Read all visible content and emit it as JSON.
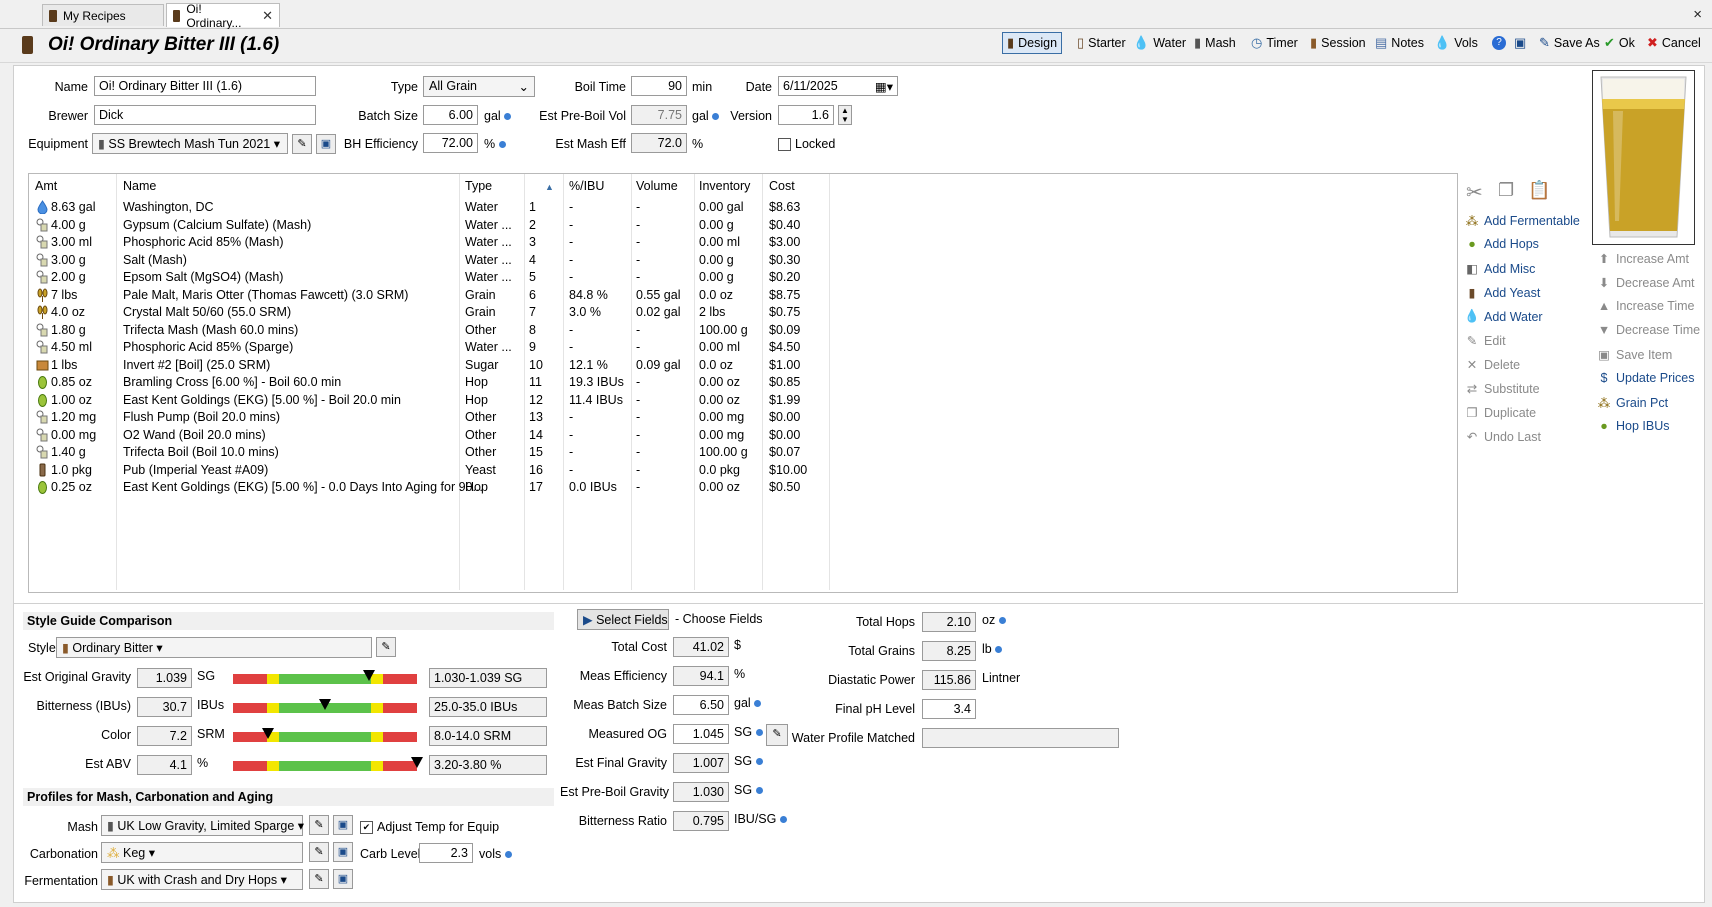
{
  "tabs": [
    {
      "label": "My Recipes",
      "active": false
    },
    {
      "label": "Oi! Ordinary...",
      "active": true
    }
  ],
  "window_close": "×",
  "recipe_title": "Oi! Ordinary Bitter III (1.6)",
  "toolbar": [
    {
      "label": "Design",
      "icon": "glass-icon",
      "selected": true
    },
    {
      "label": "Starter",
      "icon": "yeast-icon"
    },
    {
      "label": "Water",
      "icon": "water-drop-icon"
    },
    {
      "label": "Mash",
      "icon": "mash-tun-icon"
    },
    {
      "label": "Timer",
      "icon": "clock-icon"
    },
    {
      "label": "Session",
      "icon": "fermenter-icon"
    },
    {
      "label": "Notes",
      "icon": "notes-icon"
    },
    {
      "label": "Vols",
      "icon": "volume-drop-icon"
    },
    {
      "label": "",
      "icon": "help-icon"
    },
    {
      "label": "",
      "icon": "save-icon"
    },
    {
      "label": "Save As",
      "icon": "save-as-icon"
    },
    {
      "label": "Ok",
      "icon": "ok-icon"
    },
    {
      "label": "Cancel",
      "icon": "cancel-icon"
    }
  ],
  "form": {
    "name_label": "Name",
    "name_value": "Oi! Ordinary Bitter III (1.6)",
    "brewer_label": "Brewer",
    "brewer_value": "Dick",
    "equipment_label": "Equipment",
    "equipment_value": "SS Brewtech Mash Tun 2021",
    "type_label": "Type",
    "type_value": "All Grain",
    "batch_label": "Batch Size",
    "batch_value": "6.00",
    "batch_unit": "gal",
    "bh_label": "BH Efficiency",
    "bh_value": "72.00",
    "bh_unit": "%",
    "boil_label": "Boil Time",
    "boil_value": "90",
    "boil_unit": "min",
    "preboil_label": "Est Pre-Boil Vol",
    "preboil_value": "7.75",
    "preboil_unit": "gal",
    "mash_eff_label": "Est Mash Eff",
    "mash_eff_value": "72.0",
    "mash_eff_unit": "%",
    "date_label": "Date",
    "date_value": "6/11/2025",
    "version_label": "Version",
    "version_value": "1.6",
    "locked_label": "Locked"
  },
  "grid": {
    "headers": [
      "Amt",
      "Name",
      "Type",
      "",
      "%/IBU",
      "Volume",
      "Inventory",
      "Cost"
    ],
    "rows": [
      {
        "icon": "water",
        "amt": "8.63 gal",
        "name": "Washington, DC",
        "type": "Water",
        "num": "1",
        "pct": "-",
        "vol": "-",
        "inv": "0.00 gal",
        "cost": "$8.63"
      },
      {
        "icon": "misc",
        "amt": "4.00 g",
        "name": "Gypsum (Calcium Sulfate) (Mash)",
        "type": "Water ...",
        "num": "2",
        "pct": "-",
        "vol": "-",
        "inv": "0.00 g",
        "cost": "$0.40"
      },
      {
        "icon": "misc",
        "amt": "3.00 ml",
        "name": "Phosphoric Acid 85% (Mash)",
        "type": "Water ...",
        "num": "3",
        "pct": "-",
        "vol": "-",
        "inv": "0.00 ml",
        "cost": "$3.00"
      },
      {
        "icon": "misc",
        "amt": "3.00 g",
        "name": "Salt (Mash)",
        "type": "Water ...",
        "num": "4",
        "pct": "-",
        "vol": "-",
        "inv": "0.00 g",
        "cost": "$0.30"
      },
      {
        "icon": "misc",
        "amt": "2.00 g",
        "name": "Epsom Salt (MgSO4) (Mash)",
        "type": "Water ...",
        "num": "5",
        "pct": "-",
        "vol": "-",
        "inv": "0.00 g",
        "cost": "$0.20"
      },
      {
        "icon": "grain",
        "amt": "7 lbs",
        "name": "Pale Malt, Maris Otter (Thomas Fawcett) (3.0 SRM)",
        "type": "Grain",
        "num": "6",
        "pct": "84.8 %",
        "vol": "0.55 gal",
        "inv": "0.0 oz",
        "cost": "$8.75"
      },
      {
        "icon": "grain",
        "amt": "4.0 oz",
        "name": "Crystal Malt 50/60 (55.0 SRM)",
        "type": "Grain",
        "num": "7",
        "pct": "3.0 %",
        "vol": "0.02 gal",
        "inv": "2 lbs",
        "cost": "$0.75"
      },
      {
        "icon": "misc",
        "amt": "1.80 g",
        "name": "Trifecta Mash (Mash 60.0 mins)",
        "type": "Other",
        "num": "8",
        "pct": "-",
        "vol": "-",
        "inv": "100.00 g",
        "cost": "$0.09"
      },
      {
        "icon": "misc",
        "amt": "4.50 ml",
        "name": "Phosphoric Acid 85% (Sparge)",
        "type": "Water ...",
        "num": "9",
        "pct": "-",
        "vol": "-",
        "inv": "0.00 ml",
        "cost": "$4.50"
      },
      {
        "icon": "sugar",
        "amt": "1 lbs",
        "name": "Invert #2 [Boil] (25.0 SRM)",
        "type": "Sugar",
        "num": "10",
        "pct": "12.1 %",
        "vol": "0.09 gal",
        "inv": "0.0 oz",
        "cost": "$1.00"
      },
      {
        "icon": "hop",
        "amt": "0.85 oz",
        "name": "Bramling Cross [6.00 %] - Boil 60.0 min",
        "type": "Hop",
        "num": "11",
        "pct": "19.3 IBUs",
        "vol": "-",
        "inv": "0.00 oz",
        "cost": "$0.85"
      },
      {
        "icon": "hop",
        "amt": "1.00 oz",
        "name": "East Kent Goldings (EKG) [5.00 %] - Boil 20.0 min",
        "type": "Hop",
        "num": "12",
        "pct": "11.4 IBUs",
        "vol": "-",
        "inv": "0.00 oz",
        "cost": "$1.99"
      },
      {
        "icon": "misc",
        "amt": "1.20 mg",
        "name": "Flush Pump (Boil 20.0 mins)",
        "type": "Other",
        "num": "13",
        "pct": "-",
        "vol": "-",
        "inv": "0.00 mg",
        "cost": "$0.00"
      },
      {
        "icon": "misc",
        "amt": "0.00 mg",
        "name": "O2 Wand (Boil 20.0 mins)",
        "type": "Other",
        "num": "14",
        "pct": "-",
        "vol": "-",
        "inv": "0.00 mg",
        "cost": "$0.00"
      },
      {
        "icon": "misc",
        "amt": "1.40 g",
        "name": "Trifecta Boil (Boil 10.0 mins)",
        "type": "Other",
        "num": "15",
        "pct": "-",
        "vol": "-",
        "inv": "100.00 g",
        "cost": "$0.07"
      },
      {
        "icon": "yeast",
        "amt": "1.0 pkg",
        "name": "Pub (Imperial Yeast #A09)",
        "type": "Yeast",
        "num": "16",
        "pct": "-",
        "vol": "-",
        "inv": "0.0 pkg",
        "cost": "$10.00"
      },
      {
        "icon": "hop",
        "amt": "0.25 oz",
        "name": "East Kent Goldings (EKG) [5.00 %] - 0.0 Days Into Aging for 90...",
        "type": "Hop",
        "num": "17",
        "pct": "0.0 IBUs",
        "vol": "-",
        "inv": "0.00 oz",
        "cost": "$0.50"
      }
    ]
  },
  "side_buttons_left": [
    {
      "label": "Add Fermentable",
      "icon": "grain-icon",
      "enabled": true
    },
    {
      "label": "Add Hops",
      "icon": "hop-icon",
      "enabled": true
    },
    {
      "label": "Add Misc",
      "icon": "misc-icon",
      "enabled": true
    },
    {
      "label": "Add Yeast",
      "icon": "yeast-icon",
      "enabled": true
    },
    {
      "label": "Add Water",
      "icon": "water-drop-icon",
      "enabled": true
    },
    {
      "label": "Edit",
      "icon": "edit-icon",
      "enabled": false
    },
    {
      "label": "Delete",
      "icon": "delete-icon",
      "enabled": false
    },
    {
      "label": "Substitute",
      "icon": "substitute-icon",
      "enabled": false
    },
    {
      "label": "Duplicate",
      "icon": "duplicate-icon",
      "enabled": false
    },
    {
      "label": "Undo Last",
      "icon": "undo-icon",
      "enabled": false
    }
  ],
  "side_buttons_right": [
    {
      "label": "Increase Amt",
      "icon": "up-arrow-icon",
      "enabled": false
    },
    {
      "label": "Decrease Amt",
      "icon": "down-arrow-icon",
      "enabled": false
    },
    {
      "label": "Increase Time",
      "icon": "up-triangle-icon",
      "enabled": false
    },
    {
      "label": "Decrease Time",
      "icon": "down-triangle-icon",
      "enabled": false
    },
    {
      "label": "Save Item",
      "icon": "save-item-icon",
      "enabled": false
    },
    {
      "label": "Update Prices",
      "icon": "dollar-icon",
      "enabled": true
    },
    {
      "label": "Grain Pct",
      "icon": "grain-icon",
      "enabled": true
    },
    {
      "label": "Hop IBUs",
      "icon": "hop-icon",
      "enabled": true
    }
  ],
  "style_section": {
    "heading": "Style Guide Comparison",
    "style_label": "Style",
    "style_value": "Ordinary Bitter",
    "rows": [
      {
        "label": "Est Original Gravity",
        "value": "1.039",
        "unit": "SG",
        "range": "1.030-1.039 SG",
        "position": 0.74
      },
      {
        "label": "Bitterness (IBUs)",
        "value": "30.7",
        "unit": "IBUs",
        "range": "25.0-35.0 IBUs",
        "position": 0.5
      },
      {
        "label": "Color",
        "value": "7.2",
        "unit": "SRM",
        "range": "8.0-14.0 SRM",
        "position": 0.19
      },
      {
        "label": "Est ABV",
        "value": "4.1",
        "unit": "%",
        "range": "3.20-3.80 %",
        "position": 1.0
      }
    ]
  },
  "profiles": {
    "heading": "Profiles for Mash, Carbonation and Aging",
    "mash_label": "Mash",
    "mash_value": "UK Low Gravity, Limited Sparge",
    "adjust_label": "Adjust Temp for Equip",
    "adjust_checked": true,
    "carb_label": "Carbonation",
    "carb_value": "Keg",
    "carb_level_label": "Carb Level",
    "carb_level_value": "2.3",
    "carb_level_unit": "vols",
    "ferm_label": "Fermentation",
    "ferm_value": "UK with Crash and Dry Hops"
  },
  "fields": {
    "select_label": "Select Fields",
    "choose_label": "- Choose Fields",
    "items": [
      {
        "label": "Total Cost",
        "value": "41.02",
        "unit": "$"
      },
      {
        "label": "Meas Efficiency",
        "value": "94.1",
        "unit": "%"
      },
      {
        "label": "Meas Batch Size",
        "value": "6.50",
        "unit": "gal"
      },
      {
        "label": "Measured OG",
        "value": "1.045",
        "unit": "SG"
      },
      {
        "label": "Est Final Gravity",
        "value": "1.007",
        "unit": "SG"
      },
      {
        "label": "Est Pre-Boil Gravity",
        "value": "1.030",
        "unit": "SG"
      },
      {
        "label": "Bitterness Ratio",
        "value": "0.795",
        "unit": "IBU/SG"
      }
    ],
    "right_items": [
      {
        "label": "Total Hops",
        "value": "2.10",
        "unit": "oz"
      },
      {
        "label": "Total Grains",
        "value": "8.25",
        "unit": "lb"
      },
      {
        "label": "Diastatic Power",
        "value": "115.86",
        "unit": "Lintner"
      },
      {
        "label": "Final pH Level",
        "value": "3.4",
        "unit": ""
      },
      {
        "label": "Water Profile Matched",
        "value": "",
        "unit": ""
      }
    ]
  },
  "colors": {
    "accent": "#3a7fd5",
    "beer": "#c9a227",
    "bar_red": "#e04040",
    "bar_yellow": "#f2e600",
    "bar_green": "#5cc24a"
  }
}
